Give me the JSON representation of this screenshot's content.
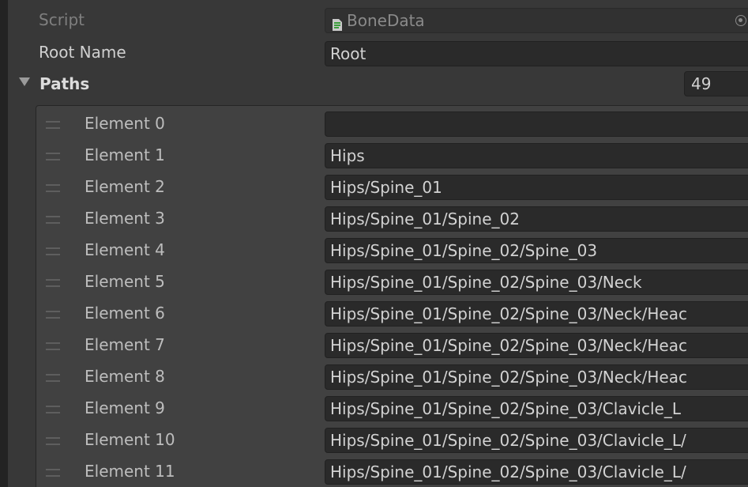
{
  "script": {
    "label": "Script",
    "value": "BoneData",
    "icon": "script-file-icon",
    "picker_icon": "object-picker-icon"
  },
  "root_name": {
    "label": "Root Name",
    "value": "Root"
  },
  "paths": {
    "label": "Paths",
    "count": "49",
    "expanded": true,
    "elements": [
      {
        "label": "Element 0",
        "value": ""
      },
      {
        "label": "Element 1",
        "value": "Hips"
      },
      {
        "label": "Element 2",
        "value": "Hips/Spine_01"
      },
      {
        "label": "Element 3",
        "value": "Hips/Spine_01/Spine_02"
      },
      {
        "label": "Element 4",
        "value": "Hips/Spine_01/Spine_02/Spine_03"
      },
      {
        "label": "Element 5",
        "value": "Hips/Spine_01/Spine_02/Spine_03/Neck"
      },
      {
        "label": "Element 6",
        "value": "Hips/Spine_01/Spine_02/Spine_03/Neck/Heac"
      },
      {
        "label": "Element 7",
        "value": "Hips/Spine_01/Spine_02/Spine_03/Neck/Heac"
      },
      {
        "label": "Element 8",
        "value": "Hips/Spine_01/Spine_02/Spine_03/Neck/Heac"
      },
      {
        "label": "Element 9",
        "value": "Hips/Spine_01/Spine_02/Spine_03/Clavicle_L"
      },
      {
        "label": "Element 10",
        "value": "Hips/Spine_01/Spine_02/Spine_03/Clavicle_L/"
      },
      {
        "label": "Element 11",
        "value": "Hips/Spine_01/Spine_02/Spine_03/Clavicle_L/"
      }
    ]
  },
  "colors": {
    "background": "#383838",
    "field_background": "#2a2a2a",
    "list_background": "#414141",
    "text": "#d2d2d2",
    "disabled_text": "#7f7f7f"
  }
}
